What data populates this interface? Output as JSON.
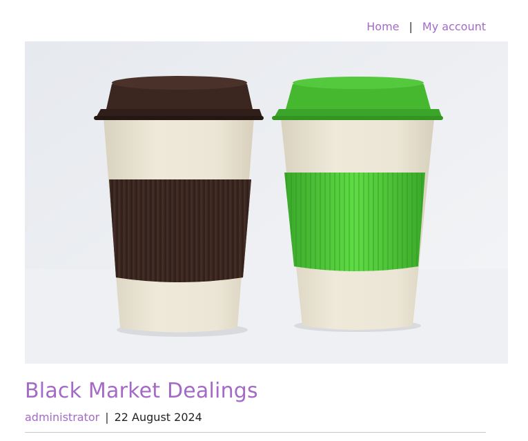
{
  "nav": {
    "home_label": "Home",
    "separator": "|",
    "account_label": "My account"
  },
  "hero": {
    "alt": "Two reusable coffee cups with brown and green lids and sleeves",
    "cup_left": {
      "lid_color": "#3b2620",
      "sleeve_color": "#3e2a24"
    },
    "cup_right": {
      "lid_color": "#45b82f",
      "sleeve_color": "#4ccc35"
    },
    "cup_body_color": "#e8e2d2"
  },
  "post": {
    "title": "Black Market Dealings",
    "author": "administrator",
    "separator": "|",
    "date": "22 August 2024"
  },
  "colors": {
    "link": "#a36ac7",
    "text": "#222222"
  }
}
